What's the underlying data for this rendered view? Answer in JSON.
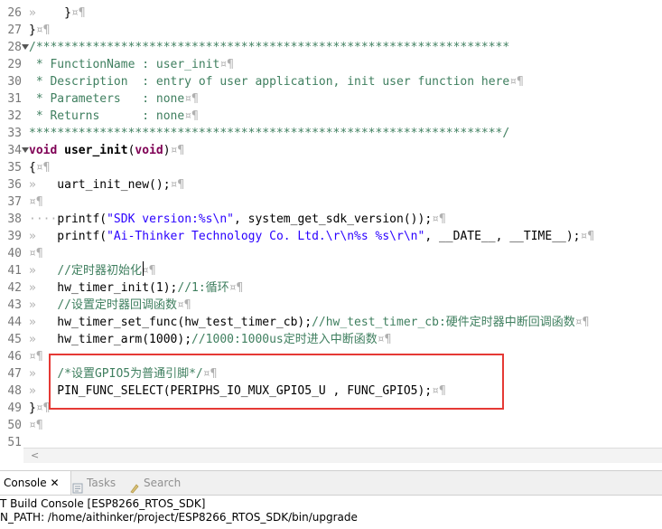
{
  "editor": {
    "lines": [
      {
        "n": "26",
        "fold": false,
        "html": "<span class=\"ws\">»</span>    }<span class=\"ws\">¤¶</span>"
      },
      {
        "n": "27",
        "fold": false,
        "html": "}<span class=\"ws\">¤¶</span>"
      },
      {
        "n": "28",
        "fold": true,
        "html": "<span class=\"cm\">/*******************************************************************</span>"
      },
      {
        "n": "29",
        "fold": false,
        "html": "<span class=\"cm\"> * FunctionName : user_init</span><span class=\"ws\">¤¶</span>"
      },
      {
        "n": "30",
        "fold": false,
        "html": "<span class=\"cm\"> * Description  : entry of user application, init user function here</span><span class=\"ws\">¤¶</span>"
      },
      {
        "n": "31",
        "fold": false,
        "html": "<span class=\"cm\"> * Parameters   : none</span><span class=\"ws\">¤¶</span>"
      },
      {
        "n": "32",
        "fold": false,
        "html": "<span class=\"cm\"> * Returns      : none</span><span class=\"ws\">¤¶</span>"
      },
      {
        "n": "33",
        "fold": false,
        "html": "<span class=\"cm\">*******************************************************************/</span>"
      },
      {
        "n": "34",
        "fold": true,
        "html": "<span class=\"kw\">void</span> <span class=\"fn\">user_init</span>(<span class=\"kw\">void</span>)<span class=\"ws\">¤¶</span>"
      },
      {
        "n": "35",
        "fold": false,
        "html": "{<span class=\"ws\">¤¶</span>"
      },
      {
        "n": "36",
        "fold": false,
        "html": "<span class=\"ws\">»</span>   uart_init_new();<span class=\"ws\">¤¶</span>"
      },
      {
        "n": "37",
        "fold": false,
        "html": "<span class=\"ws\">¤¶</span>"
      },
      {
        "n": "38",
        "fold": false,
        "html": "<span class=\"ws\">····</span>printf(<span class=\"str\">\"SDK version:%s\\n\"</span>, system_get_sdk_version());<span class=\"ws\">¤¶</span>"
      },
      {
        "n": "39",
        "fold": false,
        "html": "<span class=\"ws\">»</span>   printf(<span class=\"str\">\"Ai-Thinker Technology Co. Ltd.\\r\\n%s %s\\r\\n\"</span>, __DATE__, __TIME__);<span class=\"ws\">¤¶</span>"
      },
      {
        "n": "40",
        "fold": false,
        "html": "<span class=\"ws\">¤¶</span>"
      },
      {
        "n": "41",
        "fold": false,
        "html": "<span class=\"ws\">»</span>   <span class=\"cm\">//定时器初始化</span><span class=\"ws\">¤¶</span>"
      },
      {
        "n": "42",
        "fold": false,
        "html": "<span class=\"ws\">»</span>   hw_timer_init(1);<span class=\"cm\">//1:循环</span><span class=\"ws\">¤¶</span>"
      },
      {
        "n": "43",
        "fold": false,
        "html": "<span class=\"ws\">»</span>   <span class=\"cm\">//设置定时器回调函数</span><span class=\"ws\">¤¶</span>"
      },
      {
        "n": "44",
        "fold": false,
        "html": "<span class=\"ws\">»</span>   hw_timer_set_func(hw_test_timer_cb);<span class=\"cm\">//hw_test_timer_cb:硬件定时器中断回调函数</span><span class=\"ws\">¤¶</span>"
      },
      {
        "n": "45",
        "fold": false,
        "html": "<span class=\"ws\">»</span>   hw_timer_arm(1000);<span class=\"cm\">//1000:1000us定时进入中断函数</span><span class=\"ws\">¤¶</span>"
      },
      {
        "n": "46",
        "fold": false,
        "html": "<span class=\"ws\">¤¶</span>"
      },
      {
        "n": "47",
        "fold": false,
        "html": "<span class=\"ws\">»</span>   <span class=\"cm\">/*设置GPIO5为普通引脚*/</span><span class=\"ws\">¤¶</span>"
      },
      {
        "n": "48",
        "fold": false,
        "html": "<span class=\"ws\">»</span>   PIN_FUNC_SELECT(PERIPHS_IO_MUX_GPIO5_U , FUNC_GPIO5);<span class=\"ws\">¤¶</span>"
      },
      {
        "n": "49",
        "fold": false,
        "html": "}<span class=\"ws\">¤¶</span>"
      },
      {
        "n": "50",
        "fold": false,
        "html": "<span class=\"ws\">¤¶</span>"
      },
      {
        "n": "51",
        "fold": false,
        "html": ""
      }
    ]
  },
  "scrollbar": {
    "left_arrow": "<"
  },
  "console": {
    "tabs": [
      {
        "label": "Console",
        "suffix": " ✕",
        "active": true
      },
      {
        "label": "Tasks",
        "suffix": "",
        "active": false
      },
      {
        "label": "Search",
        "suffix": "",
        "active": false
      }
    ],
    "title": "T Build Console [ESP8266_RTOS_SDK]",
    "path": "N_PATH: /home/aithinker/project/ESP8266_RTOS_SDK/bin/upgrade"
  },
  "colors": {
    "highlight_box": "#e53935",
    "keyword": "#7f0055",
    "string": "#2a00ff",
    "comment": "#3f7f5f"
  }
}
